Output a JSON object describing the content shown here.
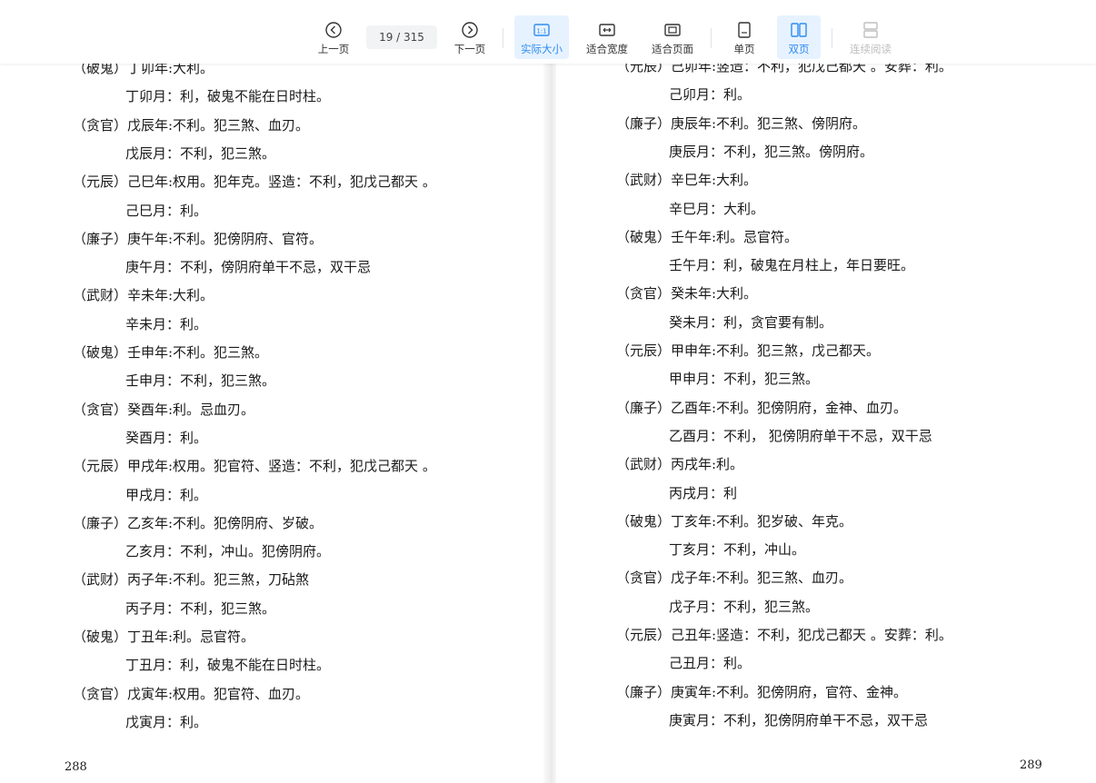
{
  "toolbar": {
    "prev": "上一页",
    "page_indicator": "19 / 315",
    "next": "下一页",
    "actual_size": "实际大小",
    "fit_width": "适合宽度",
    "fit_page": "适合页面",
    "single": "单页",
    "double": "双页",
    "continuous": "连续阅读",
    "colors": {
      "accent": "#2f8cf0",
      "active_bg": "#e6f2ff",
      "disabled": "#bfbfbf"
    }
  },
  "left_page": {
    "page_number": "288",
    "lines": [
      "（破鬼）丁卯年:大利。",
      "丁卯月：利，破鬼不能在日时柱。",
      "（贪官）戊辰年:不利。犯三煞、血刃。",
      "戊辰月：不利，犯三煞。",
      "（元辰）己巳年:权用。犯年克。竖造：不利，犯戊己都天  。",
      "己巳月：利。",
      "（廉子）庚午年:不利。犯傍阴府、官符。",
      "庚午月：不利，傍阴府单干不忌，双干忌",
      "（武财）辛未年:大利。",
      "辛未月：利。",
      "（破鬼）壬申年:不利。犯三煞。",
      "壬申月：不利，犯三煞。",
      "（贪官）癸酉年:利。忌血刃。",
      "癸酉月：利。",
      "（元辰）甲戌年:权用。犯官符、竖造：不利，犯戊己都天  。",
      "甲戌月：利。",
      "（廉子）乙亥年:不利。犯傍阴府、岁破。",
      "乙亥月：不利，冲山。犯傍阴府。",
      "（武财）丙子年:不利。犯三煞，刀砧煞",
      "丙子月：不利，犯三煞。",
      "（破鬼）丁丑年:利。忌官符。",
      "丁丑月：利，破鬼不能在日时柱。",
      "（贪官）戊寅年:权用。犯官符、血刃。",
      "戊寅月：利。"
    ]
  },
  "right_page": {
    "page_number": "289",
    "lines": [
      "（元辰）己卯年:竖造：不利，犯戊己都天  。安葬：利。",
      "己卯月：利。",
      "（廉子）庚辰年:不利。犯三煞、傍阴府。",
      "庚辰月：不利，犯三煞。傍阴府。",
      "（武财）辛巳年:大利。",
      "辛巳月：大利。",
      "（破鬼）壬午年:利。忌官符。",
      "壬午月：利，破鬼在月柱上，年日要旺。",
      "（贪官）癸未年:大利。",
      "癸未月：利，贪官要有制。",
      "（元辰）甲申年:不利。犯三煞，戊己都天。",
      "甲申月：不利，犯三煞。",
      "（廉子）乙酉年:不利。犯傍阴府，金神、血刃。",
      "乙酉月：不利，  犯傍阴府单干不忌，双干忌",
      "（武财）丙戌年:利。",
      "丙戌月：利",
      "（破鬼）丁亥年:不利。犯岁破、年克。",
      "丁亥月：不利，冲山。",
      "（贪官）戊子年:不利。犯三煞、血刃。",
      "戊子月：不利，犯三煞。",
      "（元辰）己丑年:竖造：不利，犯戊己都天  。安葬：利。",
      "己丑月：利。",
      "（廉子）庚寅年:不利。犯傍阴府，官符、金神。",
      "庚寅月：不利，犯傍阴府单干不忌，双干忌"
    ]
  }
}
